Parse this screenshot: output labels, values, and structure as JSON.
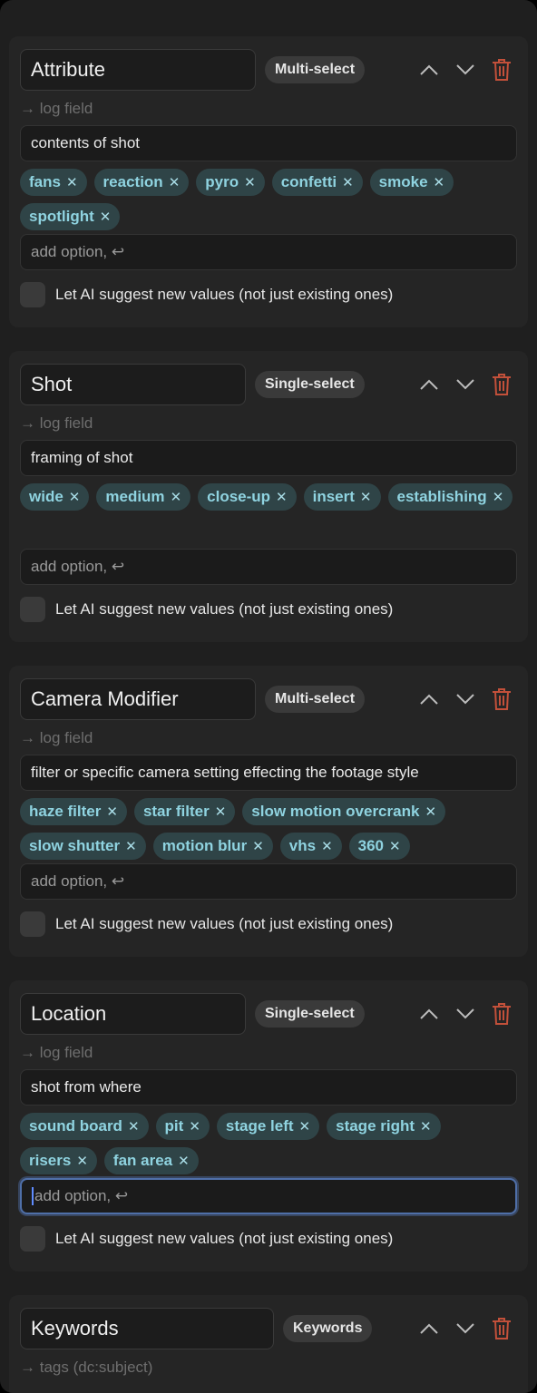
{
  "ai_label": "Let AI suggest new values (not just existing ones)",
  "add_option_placeholder": "add option, ↩",
  "colors": {
    "tag_bg": "#2f4447",
    "tag_text": "#8fd3e0",
    "trash": "#c2503a",
    "focus": "#4f6fa8"
  },
  "cards": [
    {
      "name": "Attribute",
      "type": "Multi-select",
      "log_field": "→ log field",
      "description": "contents of shot",
      "tags": [
        "fans",
        "reaction",
        "pyro",
        "confetti",
        "smoke",
        "spotlight"
      ]
    },
    {
      "name": "Shot",
      "type": "Single-select",
      "log_field": "→ log field",
      "description": "framing of shot",
      "tags": [
        "wide",
        "medium",
        "close-up",
        "insert",
        "establishing"
      ]
    },
    {
      "name": "Camera Modifier",
      "type": "Multi-select",
      "log_field": "→ log field",
      "description": "filter or specific camera setting effecting the footage style",
      "tags": [
        "haze filter",
        "star filter",
        "slow motion overcrank",
        "slow shutter",
        "motion blur",
        "vhs",
        "360"
      ]
    },
    {
      "name": "Location",
      "type": "Single-select",
      "log_field": "→ log field",
      "description": "shot from where",
      "tags": [
        "sound board",
        "pit",
        "stage left",
        "stage right",
        "risers",
        "fan area"
      ]
    },
    {
      "name": "Keywords",
      "type": "Keywords",
      "log_field": "→ tags (dc:subject)"
    }
  ]
}
